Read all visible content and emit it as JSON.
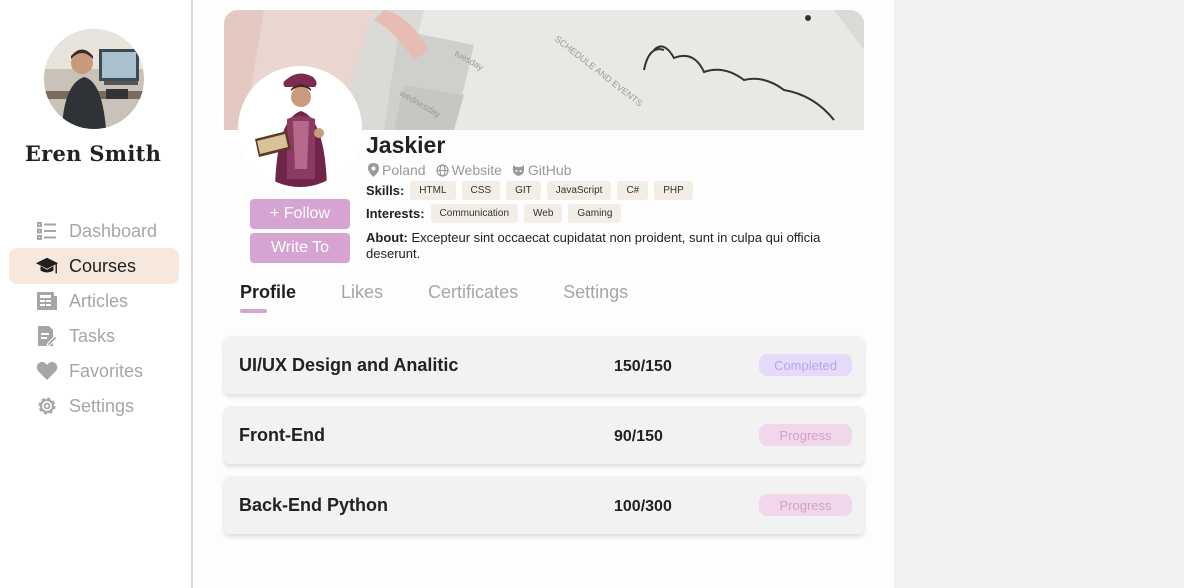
{
  "user": {
    "name": "Eren Smith"
  },
  "nav": {
    "items": [
      {
        "label": "Dashboard",
        "icon": "list-icon"
      },
      {
        "label": "Courses",
        "icon": "graduation-cap-icon"
      },
      {
        "label": "Articles",
        "icon": "newspaper-icon"
      },
      {
        "label": "Tasks",
        "icon": "task-edit-icon"
      },
      {
        "label": "Favorites",
        "icon": "heart-icon"
      },
      {
        "label": "Settings",
        "icon": "gear-icon"
      }
    ],
    "active": "Courses"
  },
  "profile": {
    "name": "Jaskier",
    "location": "Poland",
    "website": "Website",
    "github": "GitHub",
    "follow_label": "+ Follow",
    "write_label": "Write To",
    "skills_label": "Skills:",
    "skills": [
      "HTML",
      "CSS",
      "GIT",
      "JavaScript",
      "C#",
      "PHP"
    ],
    "interests_label": "Interests:",
    "interests": [
      "Communication",
      "Web",
      "Gaming"
    ],
    "about_label": "About:",
    "about_text": "Excepteur sint occaecat cupidatat non proident, sunt in culpa qui officia deserunt."
  },
  "tabs": [
    "Profile",
    "Likes",
    "Certificates",
    "Settings"
  ],
  "active_tab": "Profile",
  "courses": [
    {
      "name": "UI/UX Design and Analitic",
      "progress": "150/150",
      "status": "Completed"
    },
    {
      "name": "Front-End",
      "progress": "90/150",
      "status": "Progress"
    },
    {
      "name": "Back-End Python",
      "progress": "100/300",
      "status": "Progress"
    }
  ],
  "colors": {
    "accent": "#d6a4d2",
    "active_nav_bg": "#f6e8dc",
    "completed_bg": "#e6dafa",
    "completed_text": "#b9a3ee",
    "progress_bg": "#f0d7eb",
    "progress_text": "#d4a1c9"
  }
}
